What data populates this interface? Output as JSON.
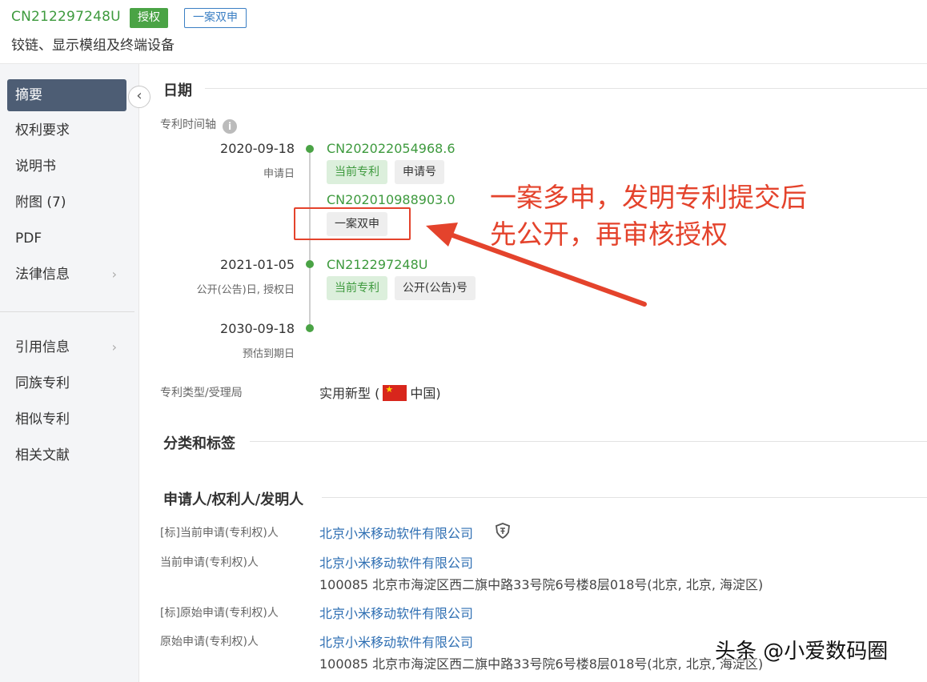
{
  "header": {
    "patent_number": "CN212297248U",
    "status_badge": "授权",
    "dual_badge": "一案双申",
    "title": "铰链、显示模组及终端设备"
  },
  "sidebar": {
    "items": [
      {
        "label": "摘要"
      },
      {
        "label": "权利要求"
      },
      {
        "label": "说明书"
      },
      {
        "label": "附图 (7)"
      },
      {
        "label": "PDF"
      },
      {
        "label": "法律信息"
      },
      {
        "label": "引用信息"
      },
      {
        "label": "同族专利"
      },
      {
        "label": "相似专利"
      },
      {
        "label": "相关文献"
      }
    ],
    "collapse_icon": "chevron-left-icon"
  },
  "main": {
    "dates_title": "日期",
    "timeline_label": "专利时间轴",
    "timeline": [
      {
        "date": "2020-09-18",
        "sub": "申请日",
        "number": "CN202022054968.6",
        "tags": [
          "当前专利",
          "申请号"
        ]
      },
      {
        "number": "CN202010988903.0",
        "tags": [
          "一案双申"
        ]
      },
      {
        "date": "2021-01-05",
        "sub": "公开(公告)日, 授权日",
        "number": "CN212297248U",
        "tags": [
          "当前专利",
          "公开(公告)号"
        ]
      },
      {
        "date": "2030-09-18",
        "sub": "预估到期日"
      }
    ],
    "type_label": "专利类型/受理局",
    "type_value": "实用新型 (",
    "country": "中国)",
    "classification_title": "分类和标签",
    "applicants_title": "申请人/权利人/发明人",
    "applicants": [
      {
        "label": "[标]当前申请(专利权)人",
        "name": "北京小米移动软件有限公司"
      },
      {
        "label": "当前申请(专利权)人",
        "name": "北京小米移动软件有限公司",
        "address": "100085 北京市海淀区西二旗中路33号院6号楼8层018号(北京, 北京, 海淀区)"
      },
      {
        "label": "[标]原始申请(专利权)人",
        "name": "北京小米移动软件有限公司"
      },
      {
        "label": "原始申请(专利权)人",
        "name": "北京小米移动软件有限公司",
        "address": "100085 北京市海淀区西二旗中路33号院6号楼8层018号(北京, 北京, 海淀区)"
      }
    ]
  },
  "annotation": {
    "line1": "一案多申，发明专利提交后",
    "line2": "先公开，再审核授权"
  },
  "watermark": "头条 @小爱数码圈",
  "colors": {
    "accent_green": "#4aa345",
    "link_blue": "#2f6fb3",
    "annotation_red": "#e4432c",
    "sidebar_active": "#4d5d74"
  }
}
